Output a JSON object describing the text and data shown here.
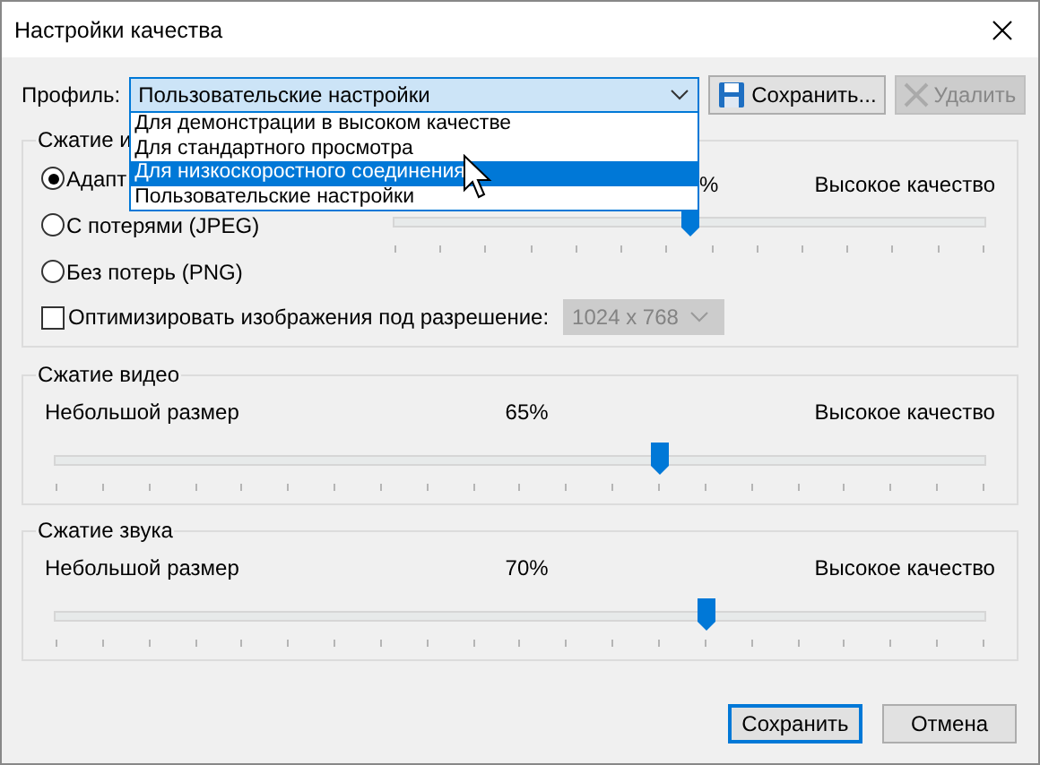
{
  "window": {
    "title": "Настройки качества"
  },
  "profile": {
    "label": "Профиль:",
    "value": "Пользовательские настройки",
    "expanded": true,
    "options": [
      {
        "label": "Для демонстрации в высоком качестве",
        "highlighted": false
      },
      {
        "label": "Для стандартного просмотра",
        "highlighted": false
      },
      {
        "label": "Для низкоскоростного соединения",
        "highlighted": true
      },
      {
        "label": "Пользовательские настройки",
        "highlighted": false
      }
    ],
    "save_button": {
      "label": "Сохранить...",
      "disabled": false
    },
    "delete_button": {
      "label": "Удалить",
      "disabled": true
    }
  },
  "image_compression": {
    "title": "Сжатие и",
    "options": [
      {
        "label": "Адапт",
        "selected": true
      },
      {
        "label": "С потерями (JPEG)",
        "selected": false
      },
      {
        "label": "Без потерь (PNG)",
        "selected": false
      }
    ],
    "slider": {
      "value_text": "%",
      "right_label": "Высокое качество",
      "level": 0.5
    },
    "optimize": {
      "label": "Оптимизировать изображения под разрешение:",
      "checked": false,
      "resolution": "1024 x 768",
      "resolution_disabled": true
    }
  },
  "video_compression": {
    "title": "Сжатие видео",
    "left_label": "Небольшой размер",
    "value_text": "65%",
    "right_label": "Высокое качество",
    "level": 0.65
  },
  "audio_compression": {
    "title": "Сжатие звука",
    "left_label": "Небольшой размер",
    "value_text": "70%",
    "right_label": "Высокое качество",
    "level": 0.7
  },
  "buttons": [
    {
      "label": "Сохранить",
      "default": true
    },
    {
      "label": "Отмена",
      "default": false
    }
  ]
}
